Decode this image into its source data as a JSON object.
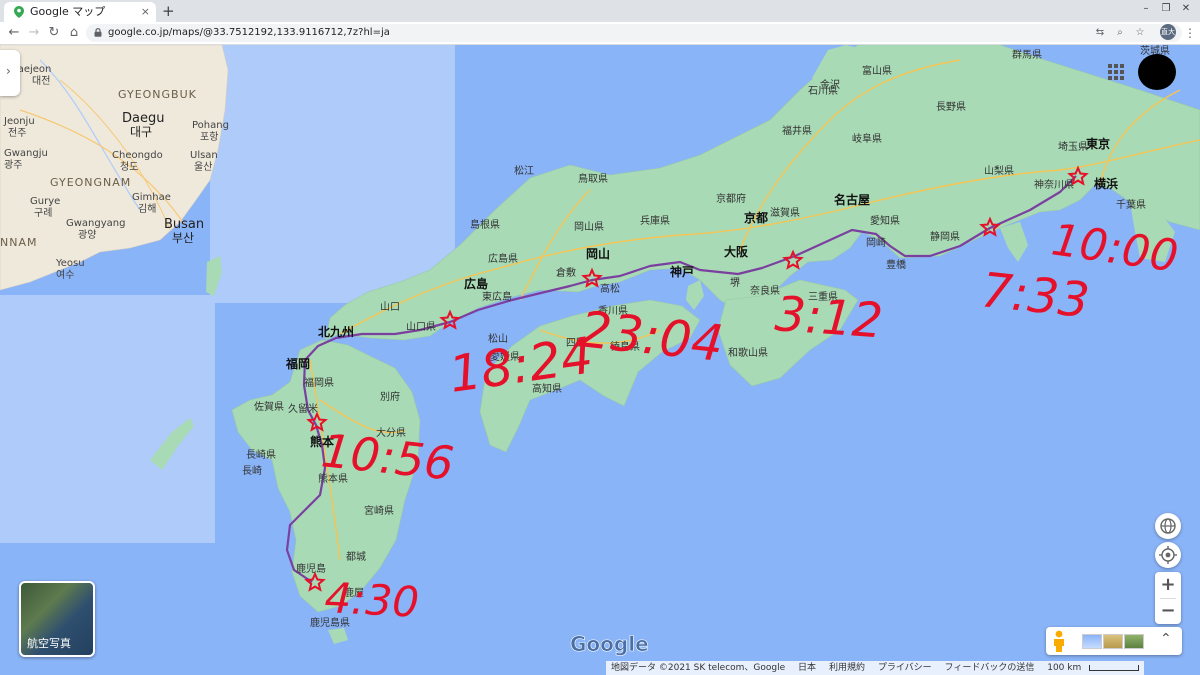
{
  "browser": {
    "tab_title": "Google マップ",
    "tab_close": "×",
    "new_tab": "+",
    "url": "google.co.jp/maps/@33.7512192,133.9116712,7z?hl=ja",
    "profile_initials": "直大"
  },
  "korea": [
    "Daejeon",
    "대전",
    "GYEONGBUK",
    "Daegu",
    "대구",
    "Pohang",
    "포항",
    "Jeonju",
    "전주",
    "Ulsan",
    "울산",
    "Cheongdo",
    "청도",
    "Gwangju",
    "광주",
    "GYEONGNAM",
    "Gimhae",
    "김해",
    "Busan",
    "부산",
    "Gurye",
    "구례",
    "Gwangyang",
    "광양",
    "NNAM",
    "Yeosu",
    "여수"
  ],
  "places": {
    "kanazawa": "金沢",
    "toyama": "富山県",
    "ishikawa": "石川県",
    "gunma": "群馬県",
    "ibaraki": "茨城県",
    "nagano": "長野県",
    "fukui": "福井県",
    "gifu": "岐阜県",
    "saitama": "埼玉県",
    "tokyo": "東京",
    "yamanashi": "山梨県",
    "kanagawa": "神奈川県",
    "yokohama": "横浜",
    "chiba": "千葉県",
    "nagoya": "名古屋",
    "shiga": "滋賀県",
    "aichi": "愛知県",
    "okazaki": "岡崎",
    "toyohashi": "豊橋",
    "shizuoka": "静岡県",
    "kyotofu": "京都府",
    "kyoto": "京都",
    "osaka": "大阪",
    "kobe": "神戸",
    "sakai": "堺",
    "nara": "奈良県",
    "mie": "三重県",
    "wakayama": "和歌山県",
    "hyogo": "兵庫県",
    "tottori": "鳥取県",
    "matsue": "松江",
    "shimane": "島根県",
    "okayama_pref": "岡山県",
    "okayama": "岡山",
    "kurashiki": "倉敷",
    "takamatsu": "高松",
    "kagawa": "香川県",
    "tokushima": "徳島県",
    "hiroshima_pref": "広島県",
    "hiroshima": "広島",
    "higashihiroshima": "東広島",
    "yamaguchi_city": "山口",
    "yamaguchi": "山口県",
    "matsuyama": "松山",
    "shikoku": "四国",
    "ehime": "愛媛県",
    "kochi": "高知県",
    "kitakyushu": "北九州",
    "fukuoka": "福岡",
    "fukuoka_pref": "福岡県",
    "saga": "佐賀県",
    "kurume": "久留米",
    "beppu": "別府",
    "oita": "大分県",
    "nagasaki_pref": "長崎県",
    "nagasaki": "長崎",
    "kumamoto": "熊本",
    "kumamoto_pref": "熊本県",
    "miyazaki": "宮崎県",
    "miyakonojo": "都城",
    "kagoshima": "鹿児島",
    "kanoya": "鹿屋",
    "kagoshima_pref": "鹿児島県"
  },
  "handwritten": [
    "10:00",
    "7:33",
    "3:12",
    "23:04",
    "18:24",
    "10:56",
    "4:30"
  ],
  "controls": {
    "aerial_label": "航空写真",
    "zoom_in": "+",
    "zoom_out": "−",
    "expand": "⌃"
  },
  "logo": "Google",
  "attribution": {
    "data": "地図データ ©2021 SK telecom、Google",
    "country": "日本",
    "terms": "利用規約",
    "privacy": "プライバシー",
    "feedback": "フィードバックの送信",
    "scale": "100 km"
  },
  "colors": {
    "sea": "#8ab4f8",
    "land": "#a8dab5",
    "korea_land": "#efe9dc",
    "route": "#7b3fa0",
    "handwriting": "#e5102a"
  }
}
